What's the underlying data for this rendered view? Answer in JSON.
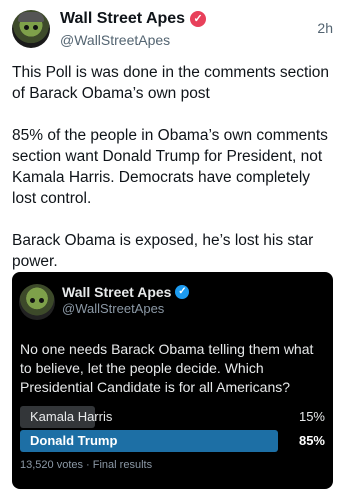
{
  "tweet": {
    "display_name": "Wall Street Apes",
    "handle": "@WallStreetApes",
    "time": "2h",
    "verified_icon": "verified-badge-icon",
    "paragraphs": [
      "This Poll is was done in the comments section of Barack Obama’s own post",
      "85% of the people in Obama’s own comments section want Donald Trump for President, not Kamala Harris. Democrats have completely lost control.",
      "Barack Obama is exposed, he’s lost his star power."
    ]
  },
  "quote": {
    "display_name": "Wall Street Apes",
    "handle": "@WallStreetApes",
    "text": "No one needs Barack Obama telling them what to believe, let the people decide. Which Presidential Candidate is for all Americans?",
    "poll": {
      "options": [
        {
          "label": "Kamala Harris",
          "percent_text": "15%",
          "fraction": 0.15
        },
        {
          "label": "Donald Trump",
          "percent_text": "85%",
          "fraction": 0.85
        }
      ],
      "meta": "13,520 votes · Final results"
    }
  },
  "colors": {
    "verified_pink": "#e8405a",
    "verified_blue": "#1d9bf0",
    "winner_bar": "#1d6fa5",
    "loser_bar": "#333639"
  }
}
